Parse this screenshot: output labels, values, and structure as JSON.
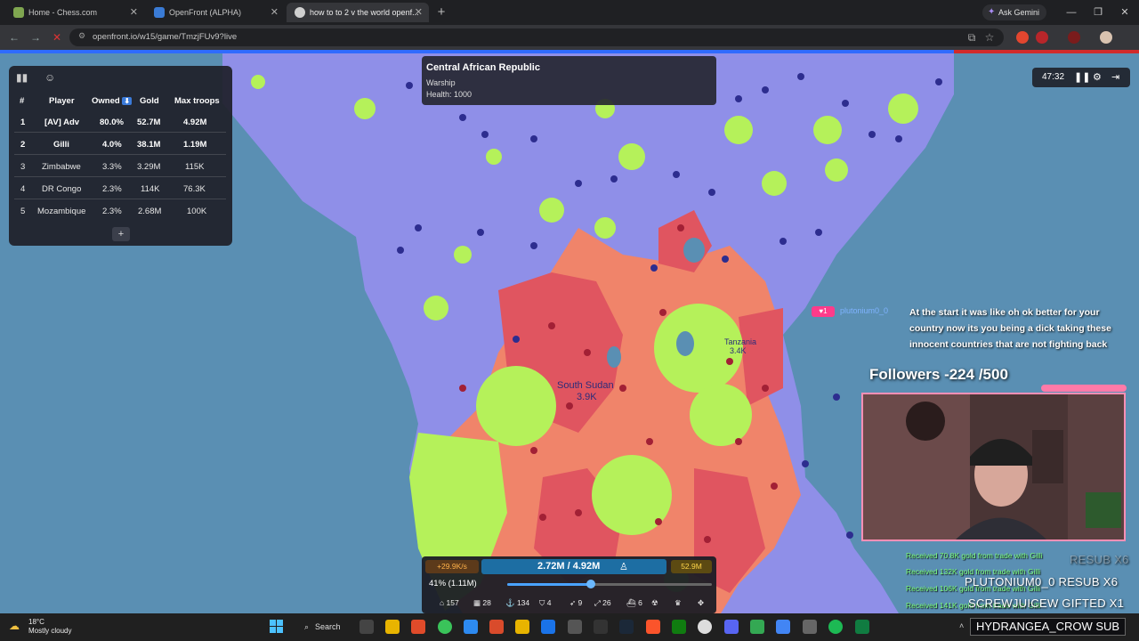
{
  "browser": {
    "tabs": [
      {
        "title": "Home - Chess.com",
        "active": false,
        "color": "#7fa650"
      },
      {
        "title": "OpenFront (ALPHA)",
        "active": false,
        "color": "#3a7bd5"
      },
      {
        "title": "how to to 2 v the world openf...",
        "active": true,
        "color": "#d0d0d0"
      }
    ],
    "new_tab": "+",
    "ask_gemini": "Ask Gemini",
    "url": "openfront.io/w15/game/TmzjFUv9?live"
  },
  "leaderboard": {
    "headers": {
      "rank": "#",
      "player": "Player",
      "owned": "Owned",
      "sort": "⬇",
      "gold": "Gold",
      "troops": "Max troops"
    },
    "rows": [
      {
        "rank": "1",
        "player": "[AV] Adv",
        "owned": "80.0%",
        "gold": "52.7M",
        "troops": "4.92M",
        "bold": true
      },
      {
        "rank": "2",
        "player": "Gilli",
        "owned": "4.0%",
        "gold": "38.1M",
        "troops": "1.19M",
        "bold": true
      },
      {
        "rank": "3",
        "player": "Zimbabwe",
        "owned": "3.3%",
        "gold": "3.29M",
        "troops": "115K",
        "bold": false
      },
      {
        "rank": "4",
        "player": "DR Congo",
        "owned": "2.3%",
        "gold": "114K",
        "troops": "76.3K",
        "bold": false
      },
      {
        "rank": "5",
        "player": "Mozambique",
        "owned": "2.3%",
        "gold": "2.68M",
        "troops": "100K",
        "bold": false
      }
    ],
    "add_button": "+"
  },
  "tooltip": {
    "title": "Central African Republic",
    "unit": "Warship",
    "health": "Health: 1000"
  },
  "game_controls": {
    "timer": "47:32"
  },
  "map_labels": {
    "south_sudan": "South Sudan",
    "south_sudan_troops": "3.9K",
    "tanzania": "Tanzania",
    "tanzania_troops": "3.4K"
  },
  "hud": {
    "gold_rate": "+29.9K/s",
    "troops": "2.72M / 4.92M",
    "gold": "52.9M",
    "attack": "41% (1.11M)",
    "attack_ratio": 0.41,
    "stats": [
      "157",
      "28",
      "134",
      "4",
      "9",
      "26",
      "6"
    ]
  },
  "stream": {
    "chat_message": "At the start it was like oh ok better for your country now its you being a dick taking these innocent countries that are not fighting back",
    "chat_user": "plutonium0_0",
    "followers": "Followers -224 /500",
    "trade_lines": [
      "Received 70.8K gold from trade with Gilli",
      "Received 132K gold from trade with Gilli",
      "Received 106K gold from trade with Gilli",
      "Received 141K gold from trade with Gilli"
    ],
    "resub_ghost": "RESUB X6",
    "plutonium_resub": "PLUTONIUM0_0   RESUB X6",
    "gifted": "SCREWJUICEW  GIFTED X1",
    "hydrangea": "HYDRANGEA_CROW  SUB"
  },
  "taskbar": {
    "temperature": "18°C",
    "weather": "Mostly cloudy",
    "search": "Search"
  },
  "colors": {
    "sea": "#5a8fb3",
    "player_territory": "#8f8fe8",
    "enemy_red": "#e05560",
    "enemy_orange": "#f0846a",
    "neutral_green": "#b5f15a",
    "accent_blue": "#2f6bff"
  }
}
